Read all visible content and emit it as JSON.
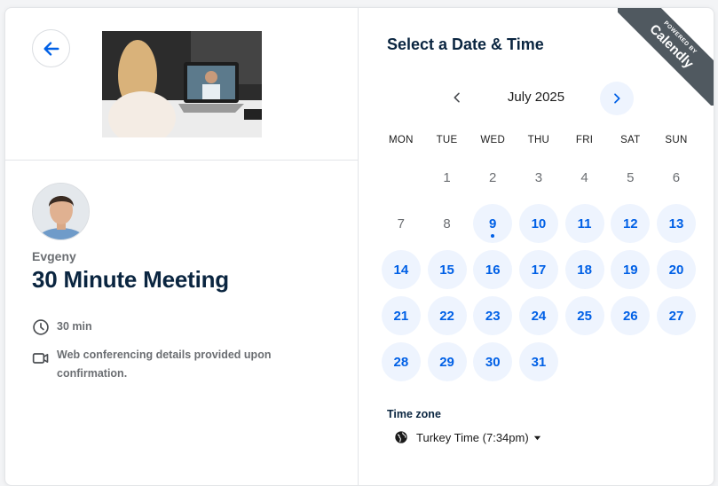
{
  "event": {
    "host_name": "Evgeny",
    "title": "30 Minute Meeting",
    "duration": "30 min",
    "location_note": "Web conferencing details provided upon confirmation."
  },
  "scheduler": {
    "heading": "Select a Date & Time",
    "month_label": "July 2025",
    "weekdays": [
      "MON",
      "TUE",
      "WED",
      "THU",
      "FRI",
      "SAT",
      "SUN"
    ],
    "days": [
      {
        "label": "",
        "state": "empty"
      },
      {
        "label": "1",
        "state": "disabled"
      },
      {
        "label": "2",
        "state": "disabled"
      },
      {
        "label": "3",
        "state": "disabled"
      },
      {
        "label": "4",
        "state": "disabled"
      },
      {
        "label": "5",
        "state": "disabled"
      },
      {
        "label": "6",
        "state": "disabled"
      },
      {
        "label": "7",
        "state": "disabled"
      },
      {
        "label": "8",
        "state": "disabled"
      },
      {
        "label": "9",
        "state": "available",
        "today": true
      },
      {
        "label": "10",
        "state": "available"
      },
      {
        "label": "11",
        "state": "available"
      },
      {
        "label": "12",
        "state": "available"
      },
      {
        "label": "13",
        "state": "available"
      },
      {
        "label": "14",
        "state": "available"
      },
      {
        "label": "15",
        "state": "available"
      },
      {
        "label": "16",
        "state": "available"
      },
      {
        "label": "17",
        "state": "available"
      },
      {
        "label": "18",
        "state": "available"
      },
      {
        "label": "19",
        "state": "available"
      },
      {
        "label": "20",
        "state": "available"
      },
      {
        "label": "21",
        "state": "available"
      },
      {
        "label": "22",
        "state": "available"
      },
      {
        "label": "23",
        "state": "available"
      },
      {
        "label": "24",
        "state": "available"
      },
      {
        "label": "25",
        "state": "available"
      },
      {
        "label": "26",
        "state": "available"
      },
      {
        "label": "27",
        "state": "available"
      },
      {
        "label": "28",
        "state": "available"
      },
      {
        "label": "29",
        "state": "available"
      },
      {
        "label": "30",
        "state": "available"
      },
      {
        "label": "31",
        "state": "available"
      }
    ],
    "timezone_label": "Time zone",
    "timezone_value": "Turkey Time (7:34pm)"
  },
  "badge": {
    "line1": "POWERED BY",
    "line2": "Calendly"
  },
  "colors": {
    "accent": "#0060e6",
    "available_bg": "#eef4fe",
    "heading": "#0a2540",
    "muted": "#6b6e72",
    "badge_bg": "#505960"
  },
  "icons": {
    "back": "arrow-left-icon",
    "prev": "chevron-left-icon",
    "next": "chevron-right-icon",
    "duration": "clock-icon",
    "location": "video-camera-icon",
    "timezone": "globe-icon",
    "dropdown": "caret-down-icon"
  }
}
